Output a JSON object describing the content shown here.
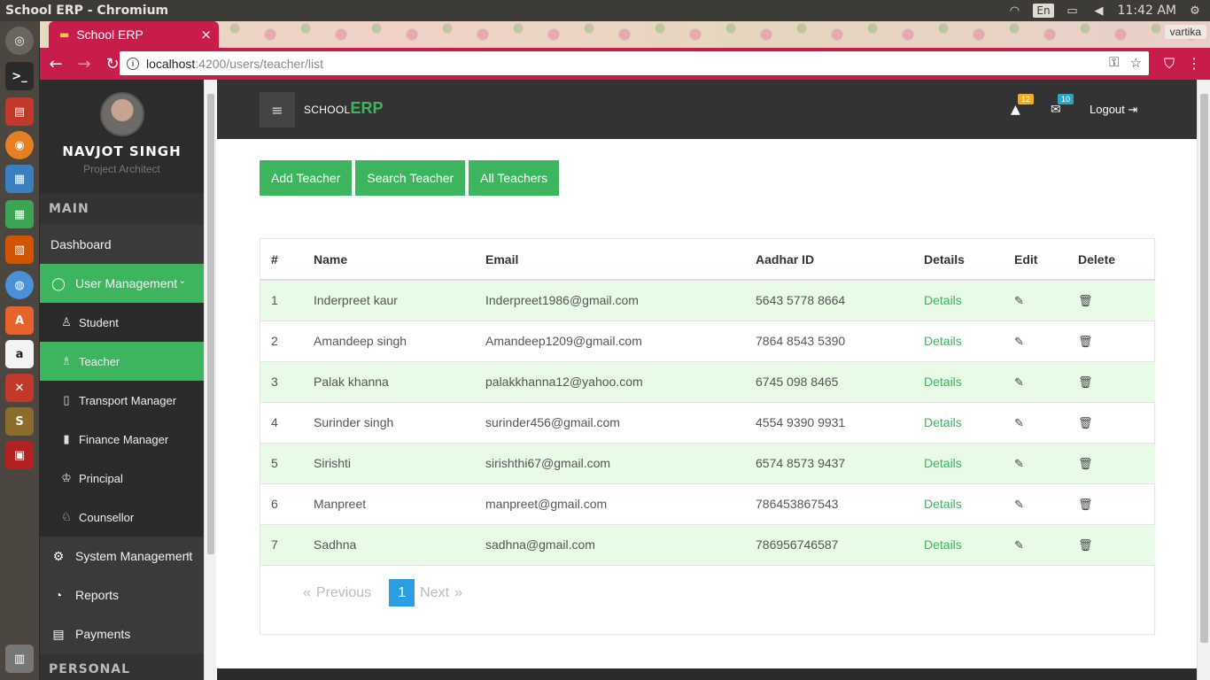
{
  "os": {
    "window_title": "School ERP - Chromium",
    "lang": "En",
    "clock": "11:42 AM"
  },
  "browser": {
    "tab_title": "School ERP",
    "tab_close": "×",
    "profile": "vartika",
    "url_host": "localhost",
    "url_rest": ":4200/users/teacher/list"
  },
  "sidebar": {
    "user_name": "NAVJOT SINGH",
    "user_role": "Project Architect",
    "section_main": "MAIN",
    "dashboard": "Dashboard",
    "user_management": "User Management",
    "sub_items": [
      "Student",
      "Teacher",
      "Transport Manager",
      "Finance Manager",
      "Principal",
      "Counsellor"
    ],
    "system_management": "System Management",
    "reports": "Reports",
    "payments": "Payments",
    "section_personal": "PERSONAL"
  },
  "header": {
    "brand_small": "SCHOOL",
    "brand_big": "ERP",
    "notif_count": "12",
    "mail_count": "10",
    "logout": "Logout",
    "notif_color": "#f0ad1c",
    "mail_color": "#2aa6c7"
  },
  "actions": {
    "add": "Add Teacher",
    "search": "Search Teacher",
    "all": "All Teachers"
  },
  "table": {
    "headers": [
      "#",
      "Name",
      "Email",
      "Aadhar ID",
      "Details",
      "Edit",
      "Delete"
    ],
    "details_label": "Details",
    "rows": [
      {
        "n": "1",
        "name": "Inderpreet kaur",
        "email": "Inderpreet1986@gmail.com",
        "aadhar": "5643 5778 8664"
      },
      {
        "n": "2",
        "name": "Amandeep singh",
        "email": "Amandeep1209@gmail.com",
        "aadhar": "7864 8543 5390"
      },
      {
        "n": "3",
        "name": "Palak khanna",
        "email": "palakkhanna12@yahoo.com",
        "aadhar": "6745 098 8465"
      },
      {
        "n": "4",
        "name": "Surinder singh",
        "email": "surinder456@gmail.com",
        "aadhar": "4554 9390 9931"
      },
      {
        "n": "5",
        "name": "Sirishti",
        "email": "sirishthi67@gmail.com",
        "aadhar": "6574 8573 9437"
      },
      {
        "n": "6",
        "name": "Manpreet",
        "email": "manpreet@gmail.com",
        "aadhar": "786453867543"
      },
      {
        "n": "7",
        "name": "Sadhna",
        "email": "sadhna@gmail.com",
        "aadhar": "786956746587"
      }
    ]
  },
  "pager": {
    "prev_arrow": "«",
    "prev": "Previous",
    "current": "1",
    "next": "Next",
    "next_arrow": "»"
  },
  "colors": {
    "accent": "#3cb55e",
    "chrome": "#c81d4b",
    "row_alt": "#e8fbe6"
  }
}
